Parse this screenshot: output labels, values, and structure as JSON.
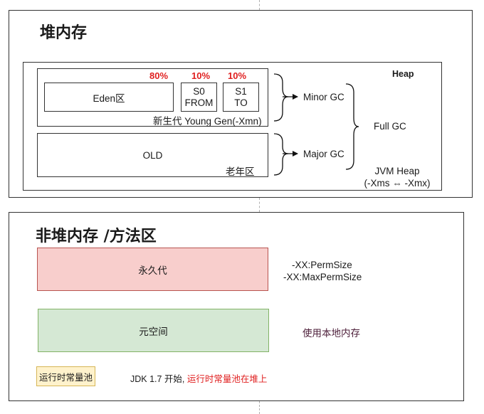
{
  "heap_section": {
    "title": "堆内存",
    "heap_label": "Heap",
    "young": {
      "eden_label": "Eden区",
      "eden_pct": "80%",
      "s0_line1": "S0",
      "s0_line2": "FROM",
      "s0_pct": "10%",
      "s1_line1": "S1",
      "s1_line2": "TO",
      "s1_pct": "10%",
      "caption": "新生代 Young Gen(-Xmn)"
    },
    "old": {
      "label": "OLD",
      "caption": "老年区"
    },
    "minor_gc": "Minor GC",
    "major_gc": "Major GC",
    "full_gc": "Full GC",
    "jvm_heap_line1": "JVM Heap",
    "jvm_heap_line2": "(-Xms ⇔ -Xmx)"
  },
  "nonheap_section": {
    "title": "非堆内存 /方法区",
    "perm": {
      "label": "永久代",
      "params_line1": "-XX:PermSize",
      "params_line2": "-XX:MaxPermSize"
    },
    "meta": {
      "label": "元空间",
      "note": "使用本地内存"
    },
    "pool": {
      "label": "运行时常量池",
      "note_prefix": "JDK 1.7 开始, ",
      "note_highlight": "运行时常量池在堆上"
    }
  },
  "colors": {
    "pct_red": "#e02020",
    "perm_fill": "#f8cecc",
    "perm_border": "#b85450",
    "meta_fill": "#d5e8d4",
    "meta_border": "#82b366",
    "pool_fill": "#fff2cc",
    "pool_border": "#d6b656",
    "meta_note": "#4d1f3a"
  }
}
